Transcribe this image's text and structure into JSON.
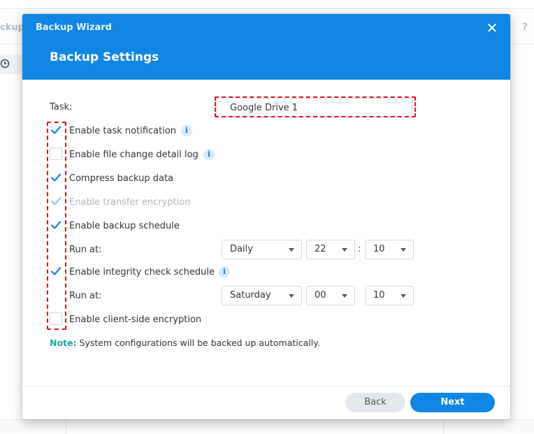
{
  "background": {
    "app_title_fragment": "ckup",
    "help_label": "?"
  },
  "dialog": {
    "wizard_title": "Backup Wizard",
    "close_label": "✕",
    "page_title": "Backup Settings"
  },
  "form": {
    "task_label": "Task:",
    "task_value": "Google Drive 1",
    "options": [
      {
        "label": "Enable task notification",
        "checked": true,
        "disabled": false,
        "info": true
      },
      {
        "label": "Enable file change detail log",
        "checked": false,
        "disabled": false,
        "info": true
      },
      {
        "label": "Compress backup data",
        "checked": true,
        "disabled": false,
        "info": false
      },
      {
        "label": "Enable transfer encryption",
        "checked": true,
        "disabled": true,
        "info": false
      },
      {
        "label": "Enable backup schedule",
        "checked": true,
        "disabled": false,
        "info": false
      },
      {
        "label": "Enable integrity check schedule",
        "checked": true,
        "disabled": false,
        "info": true
      },
      {
        "label": "Enable client-side encryption",
        "checked": false,
        "disabled": false,
        "info": false
      }
    ],
    "info_glyph": "i",
    "backup_schedule": {
      "run_at_label": "Run at:",
      "frequency": "Daily",
      "hour": "22",
      "separator": ":",
      "minute": "10"
    },
    "integrity_schedule": {
      "run_at_label": "Run at:",
      "frequency": "Saturday",
      "hour": "00",
      "minute": "10"
    }
  },
  "note": {
    "label": "Note:",
    "text": " System configurations will be backed up automatically."
  },
  "footer": {
    "back_label": "Back",
    "next_label": "Next"
  },
  "colors": {
    "header_blue": "#0f86e3",
    "checkmark": "#0f86e3",
    "highlight_red": "#e0141e",
    "note_teal": "#1aa3a3"
  }
}
